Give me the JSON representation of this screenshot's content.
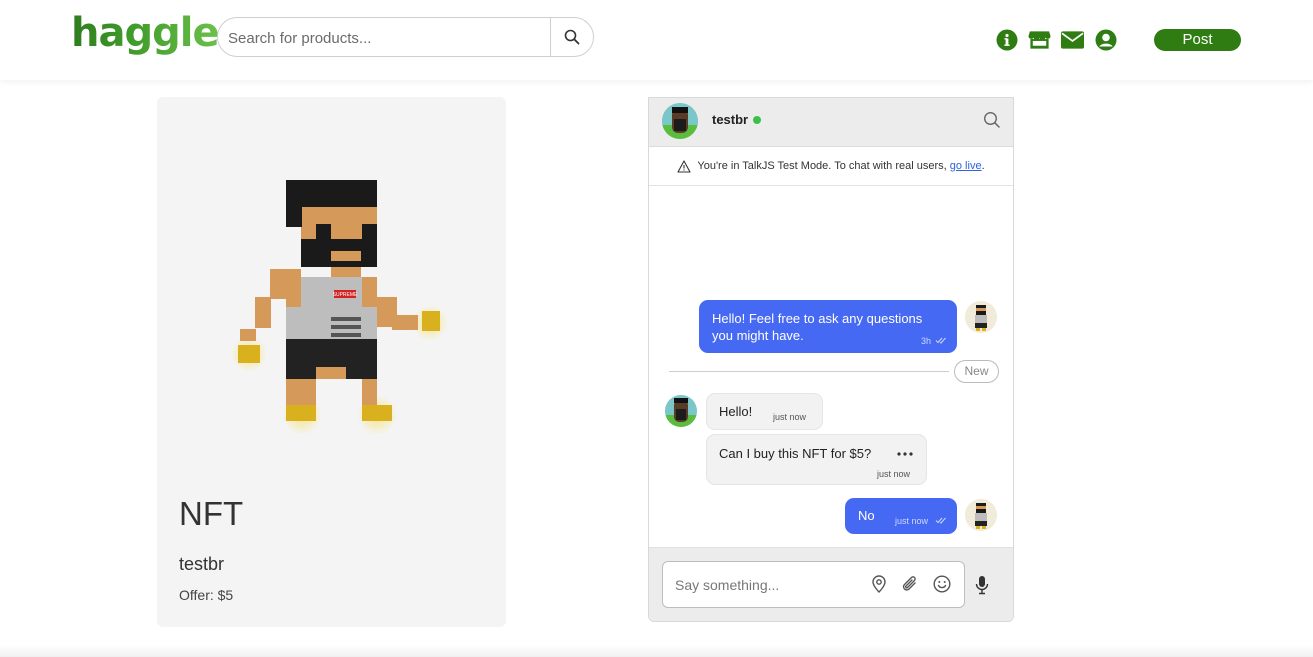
{
  "header": {
    "logo": "haggle",
    "search_placeholder": "Search for products...",
    "post_label": "Post",
    "icons": [
      "info-icon",
      "store-icon",
      "mail-icon",
      "user-icon"
    ],
    "brand_color": "#2f7d12"
  },
  "product": {
    "title": "NFT",
    "seller": "testbr",
    "offer": "Offer: $5",
    "shirt_text": "SUPREME"
  },
  "chat": {
    "contact_name": "testbr",
    "status": "online",
    "banner_text": "You're in TalkJS Test Mode. To chat with real users, ",
    "banner_link": "go live",
    "banner_end": ".",
    "messages": [
      {
        "text": "Hello! Feel free to ask any questions you might have.",
        "time": "3h",
        "direction": "out"
      },
      {
        "text": "Hello!",
        "time": "just now",
        "direction": "in"
      },
      {
        "text": "Can I buy this NFT for $5?",
        "time": "just now",
        "direction": "in"
      },
      {
        "text": "No",
        "time": "just now",
        "direction": "out"
      }
    ],
    "new_label": "New",
    "compose_placeholder": "Say something...",
    "accent_color": "#4669f3"
  }
}
